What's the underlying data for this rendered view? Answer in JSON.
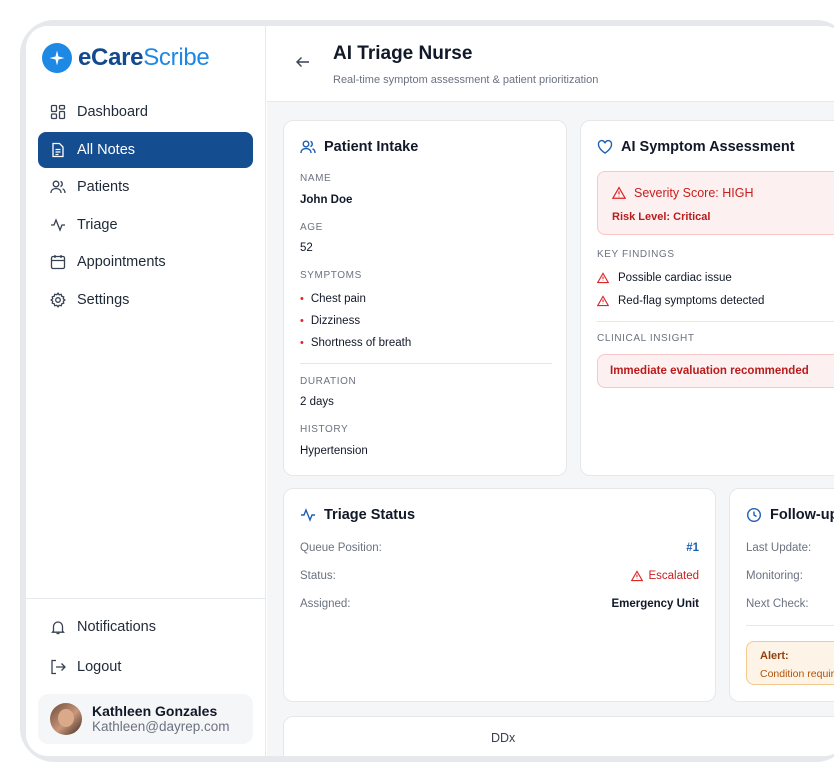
{
  "brand": {
    "name_bold": "eCare",
    "name_light": "Scribe",
    "color": "#1e88e5"
  },
  "sidebar": {
    "items": [
      {
        "label": "Dashboard",
        "icon": "grid-icon",
        "active": false
      },
      {
        "label": "All Notes",
        "icon": "document-icon",
        "active": true
      },
      {
        "label": "Patients",
        "icon": "users-icon",
        "active": false
      },
      {
        "label": "Triage",
        "icon": "activity-icon",
        "active": false
      },
      {
        "label": "Appointments",
        "icon": "calendar-icon",
        "active": false
      },
      {
        "label": "Settings",
        "icon": "gear-icon",
        "active": false
      }
    ],
    "bottom": [
      {
        "label": "Notifications",
        "icon": "bell-icon"
      },
      {
        "label": "Logout",
        "icon": "logout-icon"
      }
    ],
    "user": {
      "name": "Kathleen Gonzales",
      "email": "Kathleen@dayrep.com"
    }
  },
  "header": {
    "title": "AI Triage Nurse",
    "subtitle": "Real-time symptom assessment & patient prioritization"
  },
  "intake": {
    "title": "Patient Intake",
    "name_label": "NAME",
    "name": "John Doe",
    "age_label": "AGE",
    "age": "52",
    "symptoms_label": "SYMPTOMS",
    "symptoms": [
      "Chest pain",
      "Dizziness",
      "Shortness of breath"
    ],
    "duration_label": "DURATION",
    "duration": "2 days",
    "history_label": "HISTORY",
    "history": "Hypertension"
  },
  "assessment": {
    "title": "AI Symptom Assessment",
    "severity": "Severity Score: HIGH",
    "risk": "Risk Level: Critical",
    "findings_label": "KEY FINDINGS",
    "findings": [
      "Possible cardiac issue",
      "Red-flag symptoms detected"
    ],
    "insight_label": "CLINICAL INSIGHT",
    "insight": "Immediate evaluation recommended"
  },
  "triage": {
    "title": "Triage Status",
    "rows": [
      {
        "label": "Queue Position:",
        "value": "#1"
      },
      {
        "label": "Status:",
        "value": "Escalated"
      },
      {
        "label": "Assigned:",
        "value": "Emergency Unit"
      }
    ]
  },
  "followup": {
    "title": "Follow-up",
    "rows": [
      "Last Update:",
      "Monitoring:",
      "Next Check:"
    ],
    "alert_title": "Alert:",
    "alert_text": "Condition requires"
  },
  "ddx_label": "DDx",
  "colors": {
    "accent": "#144e91",
    "danger": "#c81e1e",
    "warning": "#b45309"
  }
}
